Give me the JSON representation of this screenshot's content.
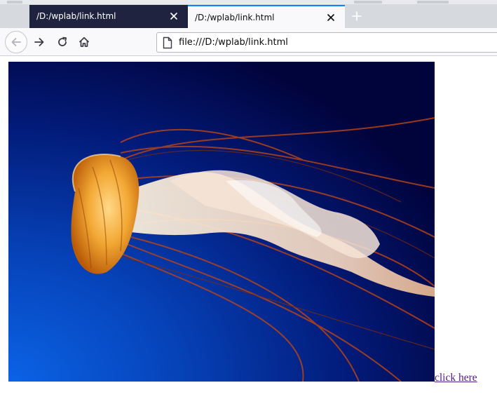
{
  "browser": {
    "tabs": [
      {
        "title": "/D:/wplab/link.html",
        "active": false
      },
      {
        "title": "/D:/wplab/link.html",
        "active": true
      }
    ],
    "toolbar": {
      "back_icon": "arrow-left-icon",
      "forward_icon": "arrow-right-icon",
      "reload_icon": "reload-icon",
      "home_icon": "home-icon"
    },
    "url": "file:///D:/wplab/link.html",
    "colors": {
      "inactive_tab_bg": "#202340",
      "active_tab_bg": "#f9f9fb",
      "active_tab_accent": "#0a84ff"
    }
  },
  "page": {
    "image": {
      "subject": "jellyfish"
    },
    "link_text": "click here",
    "link_color": "#551a8b"
  }
}
